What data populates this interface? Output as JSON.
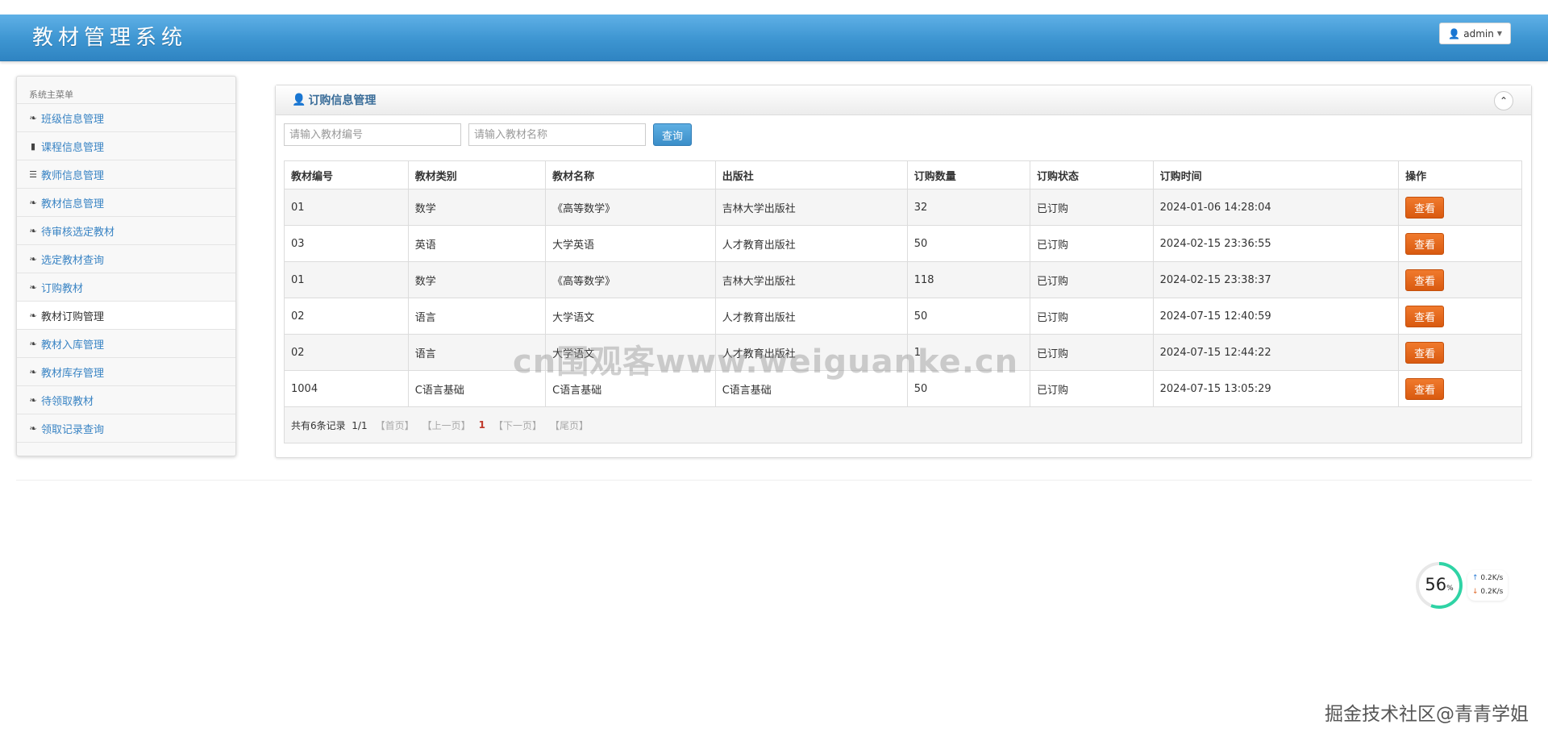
{
  "header": {
    "app_title": "教材管理系统",
    "user_label": "admin"
  },
  "sidebar": {
    "title": "系统主菜单",
    "items": [
      {
        "label": "班级信息管理",
        "icon": "leaf-icon"
      },
      {
        "label": "课程信息管理",
        "icon": "bookmark-icon"
      },
      {
        "label": "教师信息管理",
        "icon": "list-icon"
      },
      {
        "label": "教材信息管理",
        "icon": "leaf-icon"
      },
      {
        "label": "待审核选定教材",
        "icon": "leaf-icon"
      },
      {
        "label": "选定教材查询",
        "icon": "leaf-icon"
      },
      {
        "label": "订购教材",
        "icon": "leaf-icon"
      },
      {
        "label": "教材订购管理",
        "icon": "leaf-icon",
        "active": true
      },
      {
        "label": "教材入库管理",
        "icon": "leaf-icon"
      },
      {
        "label": "教材库存管理",
        "icon": "leaf-icon"
      },
      {
        "label": "待领取教材",
        "icon": "leaf-icon"
      },
      {
        "label": "领取记录查询",
        "icon": "leaf-icon"
      }
    ]
  },
  "panel": {
    "title": "订购信息管理",
    "search": {
      "code_placeholder": "请输入教材编号",
      "name_placeholder": "请输入教材名称",
      "query_label": "查询"
    },
    "table": {
      "columns": [
        "教材编号",
        "教材类别",
        "教材名称",
        "出版社",
        "订购数量",
        "订购状态",
        "订购时间",
        "操作"
      ],
      "rows": [
        {
          "code": "01",
          "category": "数学",
          "name": "《高等数学》",
          "publisher": "吉林大学出版社",
          "qty": "32",
          "status": "已订购",
          "time": "2024-01-06 14:28:04",
          "action": "查看"
        },
        {
          "code": "03",
          "category": "英语",
          "name": "大学英语",
          "publisher": "人才教育出版社",
          "qty": "50",
          "status": "已订购",
          "time": "2024-02-15 23:36:55",
          "action": "查看"
        },
        {
          "code": "01",
          "category": "数学",
          "name": "《高等数学》",
          "publisher": "吉林大学出版社",
          "qty": "118",
          "status": "已订购",
          "time": "2024-02-15 23:38:37",
          "action": "查看"
        },
        {
          "code": "02",
          "category": "语言",
          "name": "大学语文",
          "publisher": "人才教育出版社",
          "qty": "50",
          "status": "已订购",
          "time": "2024-07-15 12:40:59",
          "action": "查看"
        },
        {
          "code": "02",
          "category": "语言",
          "name": "大学语文",
          "publisher": "人才教育出版社",
          "qty": "1",
          "status": "已订购",
          "time": "2024-07-15 12:44:22",
          "action": "查看"
        },
        {
          "code": "1004",
          "category": "C语言基础",
          "name": "C语言基础",
          "publisher": "C语言基础",
          "qty": "50",
          "status": "已订购",
          "time": "2024-07-15 13:05:29",
          "action": "查看"
        }
      ]
    },
    "pager": {
      "summary": "共有6条记录",
      "page_info": "1/1",
      "first": "【首页】",
      "prev": "【上一页】",
      "current": "1",
      "next": "【下一页】",
      "last": "【尾页】"
    }
  },
  "net_widget": {
    "percent": "56",
    "percent_unit": "%",
    "up_speed": "0.2K/s",
    "down_speed": "0.2K/s"
  },
  "watermarks": {
    "center": "cn围观客www.weiguanke.cn",
    "corner": "掘金技术社区@青青学姐"
  },
  "colors": {
    "header_blue": "#3d95d1",
    "link_blue": "#3a84c4",
    "action_orange": "#e0661a"
  }
}
